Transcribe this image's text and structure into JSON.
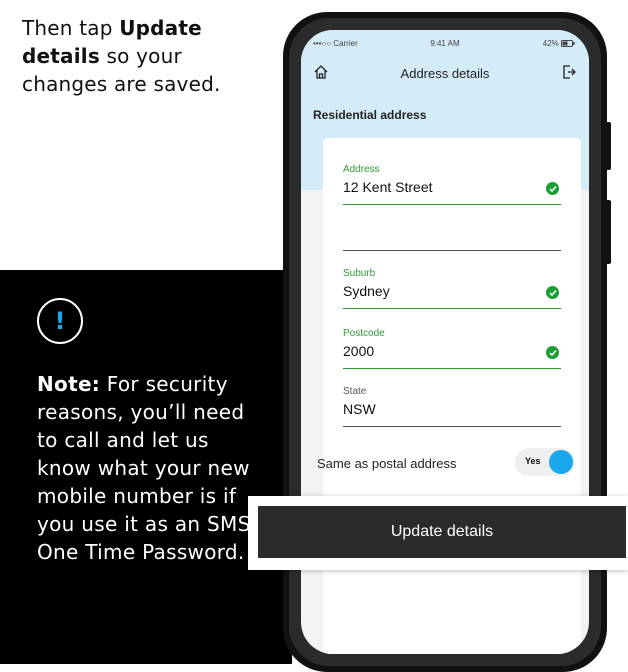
{
  "instruction": {
    "prefix": "Then tap ",
    "bold": "Update details",
    "suffix": " so your changes are saved."
  },
  "note": {
    "icon": "exclamation-icon",
    "icon_glyph": "!",
    "bold": "Note:",
    "text": " For security reasons, you’ll need to call and let us know what your new mobile number is if you use it as an SMS One Time Password."
  },
  "status_bar": {
    "carrier": "•••○○ Carrier",
    "time": "9:41 AM",
    "battery": "42%"
  },
  "header": {
    "title": "Address details",
    "home_icon": "home-icon",
    "logout_icon": "logout-icon"
  },
  "section": {
    "title": "Residential address"
  },
  "fields": {
    "address": {
      "label": "Address",
      "value": "12 Kent Street",
      "valid": true
    },
    "address_line2": {
      "value": ""
    },
    "suburb": {
      "label": "Suburb",
      "value": "Sydney",
      "valid": true
    },
    "postcode": {
      "label": "Postcode",
      "value": "2000",
      "valid": true
    },
    "state": {
      "label": "State",
      "value": "NSW"
    }
  },
  "toggle": {
    "label": "Same as postal address",
    "value": "Yes",
    "on": true
  },
  "actions": {
    "update_label": "Update details"
  },
  "colors": {
    "accent": "#1aa7ec",
    "success": "#1f9d35",
    "header_bg": "#d4ebf8",
    "button_bg": "#2b2b2b"
  }
}
